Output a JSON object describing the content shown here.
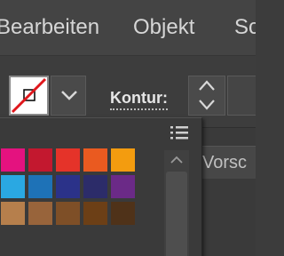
{
  "menubar": {
    "items": [
      {
        "label": "Bearbeiten"
      },
      {
        "label": "Objekt"
      },
      {
        "label": "Sc"
      }
    ]
  },
  "controlbar": {
    "fill_swatch": {
      "icon": "no-fill-swatch-icon",
      "state": "none"
    },
    "dropdown_icon": "chevron-down-icon",
    "stroke_label": "Kontur:",
    "stepper_icons": [
      "chevron-up-icon",
      "chevron-down-icon"
    ]
  },
  "background_panel": {
    "tab_label": "Vorsc"
  },
  "swatch_popup": {
    "menu_icon": "list-menu-icon",
    "scroll_up_icon": "chevron-up-icon",
    "swatch_rows": [
      [
        "#e4127f",
        "#c3182f",
        "#e53329",
        "#ea5a20",
        "#f39c0f"
      ],
      [
        "#2aa8e2",
        "#1e72b7",
        "#2b3289",
        "#2c2c69",
        "#6b2a87"
      ],
      [
        "#b67f4c",
        "#98643b",
        "#7e4f27",
        "#6c3f16",
        "#4f3219"
      ]
    ]
  },
  "colors": {
    "menubar_bg": "#444444",
    "panel_bg": "#3a3a3a",
    "text": "#d6d6d6",
    "no_fill_slash": "#e0161b"
  }
}
